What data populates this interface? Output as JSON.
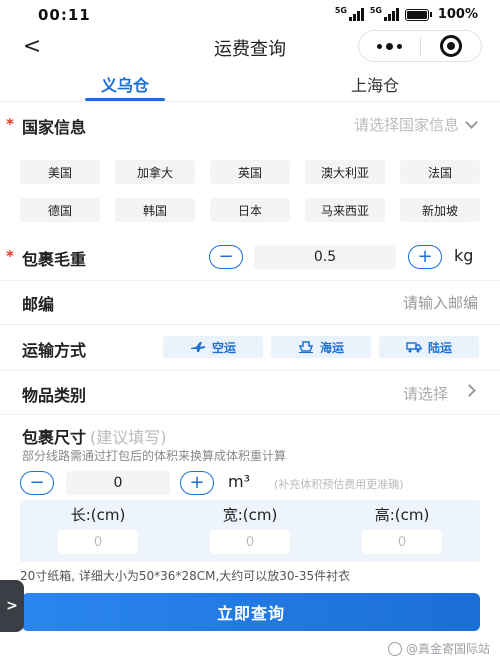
{
  "status_bar": {
    "time": "00:11",
    "signal_1": "5G",
    "signal_2": "5G",
    "battery": "100%"
  },
  "nav": {
    "title": "运费查询",
    "back_glyph": "<"
  },
  "tabs": [
    {
      "label": "义乌仓",
      "active": true
    },
    {
      "label": "上海仓",
      "active": false
    }
  ],
  "country": {
    "label": "国家信息",
    "placeholder": "请选择国家信息",
    "options": [
      "美国",
      "加拿大",
      "英国",
      "澳大利亚",
      "法国",
      "德国",
      "韩国",
      "日本",
      "马来西亚",
      "新加坡"
    ]
  },
  "weight": {
    "label": "包裹毛重",
    "value": "0.5",
    "unit": "kg",
    "minus": "−",
    "plus": "+"
  },
  "postcode": {
    "label": "邮编",
    "placeholder": "请输入邮编"
  },
  "transport": {
    "label": "运输方式",
    "options": [
      {
        "label": "空运",
        "icon": "plane-icon"
      },
      {
        "label": "海运",
        "icon": "ship-icon"
      },
      {
        "label": "陆运",
        "icon": "truck-icon"
      }
    ]
  },
  "category": {
    "label": "物品类别",
    "placeholder": "请选择"
  },
  "size": {
    "label": "包裹尺寸",
    "suggestion": "(建议填写)",
    "hint": "部分线路需通过打包后的体积来换算成体积重计算",
    "volume_value": "0",
    "volume_unit": "m³",
    "volume_note": "(补充体积预估费用更准确)",
    "dimensions": [
      {
        "label": "长:(cm)",
        "value": "0"
      },
      {
        "label": "宽:(cm)",
        "value": "0"
      },
      {
        "label": "高:(cm)",
        "value": "0"
      }
    ],
    "box_note": "20寸纸箱, 详细大小为50*36*28CM,大约可以放30-35件衬衣"
  },
  "submit_label": "立即查询",
  "side_handle_glyph": ">",
  "watermark": "@真金寄国际站",
  "colors": {
    "accent": "#1a6fd6",
    "required": "#e23b2e",
    "chip_bg": "#f3f4f6",
    "transport_bg": "#eaf2fc"
  }
}
